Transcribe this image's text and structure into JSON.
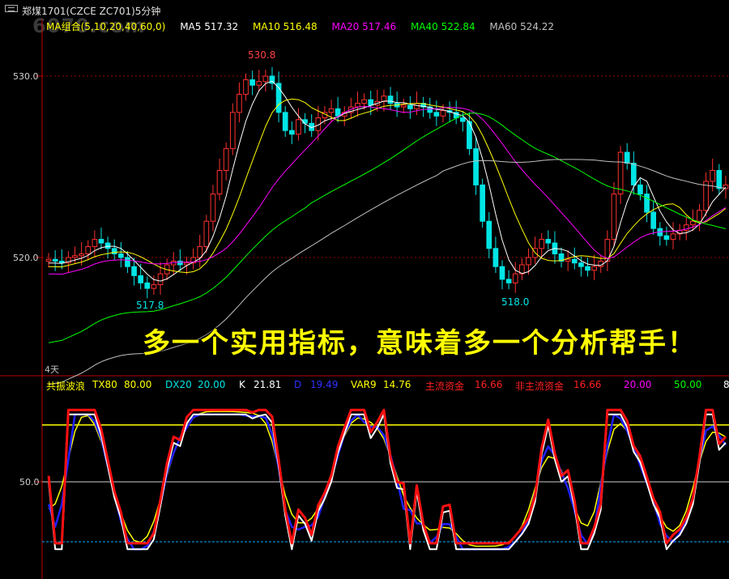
{
  "window": {
    "title": "郑煤1701(CZCE ZC701)5分钟",
    "watermark": "6070.com"
  },
  "ma_legend": {
    "group": "MA组合(5,10,20,40,60,0)",
    "items": [
      {
        "label": "MA5 517.32",
        "color": "#ffffff"
      },
      {
        "label": "MA10 516.48",
        "color": "#ffff00"
      },
      {
        "label": "MA20 517.46",
        "color": "#ff00ff"
      },
      {
        "label": "MA40 522.84",
        "color": "#00ff00"
      },
      {
        "label": "MA60 524.22",
        "color": "#c0c0c0"
      }
    ],
    "group_color": "#ffff00"
  },
  "price_axis": {
    "labels": [
      "530.0",
      "520.0"
    ]
  },
  "annotations": {
    "high": "530.8",
    "low_left": "517.8",
    "low_mid": "518.0"
  },
  "headline": "多一个实用指标，意味着多一个分析帮手！",
  "period_label": "4天",
  "indicator_legend": {
    "items": [
      {
        "label": "共振波浪",
        "color": "#ffff00"
      },
      {
        "label": "TX80",
        "color": "#ffff00"
      },
      {
        "label": "80.00",
        "color": "#ffff00"
      },
      {
        "label": "DX20",
        "color": "#00e5e5"
      },
      {
        "label": "20.00",
        "color": "#00e5e5"
      },
      {
        "label": "K",
        "color": "#ffffff"
      },
      {
        "label": "21.81",
        "color": "#ffffff"
      },
      {
        "label": "D",
        "color": "#3030ff"
      },
      {
        "label": "19.49",
        "color": "#3030ff"
      },
      {
        "label": "VAR9",
        "color": "#ffff00"
      },
      {
        "label": "14.76",
        "color": "#ffff00"
      },
      {
        "label": "主流资金",
        "color": "#ff2020"
      },
      {
        "label": "16.66",
        "color": "#ff2020"
      },
      {
        "label": "非主流资金",
        "color": "#ff2020"
      },
      {
        "label": "16.66",
        "color": "#ff2020"
      },
      {
        "label": "20.00",
        "color": "#ff00ff"
      },
      {
        "label": "50.00",
        "color": "#00ff00"
      },
      {
        "label": "8",
        "color": "#ffffff"
      }
    ]
  },
  "indicator_axis": {
    "labels": [
      "50.0"
    ]
  },
  "chart_data": [
    {
      "type": "candlestick",
      "title": "郑煤1701(CZCE ZC701)5分钟",
      "ylim": [
        514,
        532
      ],
      "yticks": [
        520.0,
        530.0
      ],
      "candles_close": [
        519.9,
        519.8,
        519.7,
        520.0,
        520.1,
        520.2,
        520.6,
        521.0,
        520.8,
        520.5,
        520.2,
        520.0,
        519.5,
        519.0,
        518.6,
        518.3,
        518.5,
        519.1,
        519.6,
        519.8,
        519.6,
        519.7,
        520.0,
        520.6,
        522.0,
        523.5,
        524.8,
        526.0,
        528.0,
        529.0,
        529.8,
        529.5,
        529.7,
        530.0,
        529.6,
        528.0,
        527.0,
        526.8,
        527.6,
        527.4,
        527.0,
        527.7,
        528.0,
        528.2,
        527.8,
        528.0,
        528.3,
        528.5,
        528.7,
        528.4,
        528.6,
        528.9,
        528.5,
        528.3,
        528.4,
        528.2,
        528.5,
        528.3,
        528.0,
        527.8,
        528.1,
        528.0,
        527.7,
        527.5,
        526.0,
        524.0,
        522.0,
        520.5,
        519.5,
        518.8,
        518.6,
        519.1,
        519.6,
        520.0,
        520.5,
        521.0,
        520.8,
        520.2,
        519.8,
        519.9,
        519.7,
        519.5,
        519.3,
        519.5,
        519.8,
        521.0,
        523.5,
        525.8,
        525.2,
        524.0,
        523.5,
        522.5,
        521.6,
        521.2,
        521.0,
        521.3,
        521.5,
        521.8,
        522.0,
        522.6,
        524.2,
        524.8,
        523.8,
        524.0
      ],
      "ma_lines": [
        {
          "name": "MA5",
          "value": 517.32
        },
        {
          "name": "MA10",
          "value": 516.48
        },
        {
          "name": "MA20",
          "value": 517.46
        },
        {
          "name": "MA40",
          "value": 522.84
        },
        {
          "name": "MA60",
          "value": 524.22
        }
      ],
      "annotations": [
        {
          "label": "530.8"
        },
        {
          "label": "517.8"
        },
        {
          "label": "518.0"
        }
      ]
    },
    {
      "type": "line",
      "title": "共振波浪",
      "yticks": [
        50.0
      ],
      "reference_lines": [
        80.0,
        20.0
      ],
      "series": [
        {
          "name": "K",
          "last": 21.81,
          "color": "#ffffff"
        },
        {
          "name": "D",
          "last": 19.49,
          "color": "#3030ff"
        },
        {
          "name": "VAR9",
          "last": 14.76,
          "color": "#ffff00"
        },
        {
          "name": "主流资金",
          "last": 16.66,
          "color": "#ff2020"
        }
      ]
    }
  ]
}
